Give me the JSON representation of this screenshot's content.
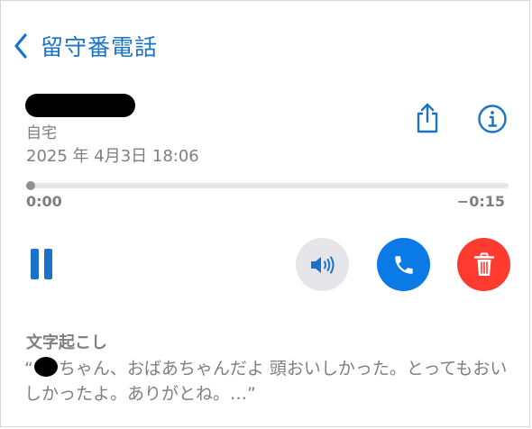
{
  "nav": {
    "back_title": "留守番電話"
  },
  "voicemail": {
    "caller_label": "自宅",
    "date": "2025 年 4月3日 18:06"
  },
  "playback": {
    "elapsed": "0:00",
    "remaining": "−0:15",
    "progress_fraction": 0.01
  },
  "icons": {
    "back": "chevron-left-icon",
    "share": "share-icon",
    "info": "info-icon",
    "pause": "pause-icon",
    "speaker": "speaker-icon",
    "call": "phone-icon",
    "delete": "trash-icon"
  },
  "colors": {
    "accent": "#1a73c9",
    "call": "#0a7ae6",
    "delete": "#ff3b30",
    "secondary_text": "#7f7f83"
  },
  "transcription": {
    "title": "文字起こし",
    "open_quote": "“",
    "text": "ちゃん、おばあちゃんだよ 頭おいしかった。とってもおいしかったよ。ありがとね。…”"
  }
}
